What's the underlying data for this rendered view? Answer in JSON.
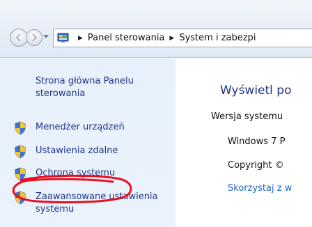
{
  "address_bar": {
    "breadcrumb": [
      "Panel sterowania",
      "System i zabezpi"
    ]
  },
  "left_pane": {
    "home_link": "Strona główna Panelu sterowania",
    "tasks": [
      {
        "label": "Menedżer urządzeń",
        "icon": "shield-icon",
        "highlighted": true
      },
      {
        "label": "Ustawienia zdalne",
        "icon": "shield-icon"
      },
      {
        "label": "Ochrona systemu",
        "icon": "shield-icon"
      },
      {
        "label": "Zaawansowane ustawienia systemu",
        "icon": "shield-icon"
      }
    ],
    "annotation_color": "#e8101e"
  },
  "content": {
    "title": "Wyświetl po",
    "section_label": "Wersja systemu",
    "edition": "Windows 7 P",
    "copyright": "Copyright ©",
    "more_link": "Skorzystaj z w"
  },
  "colors": {
    "link": "#1e3287",
    "pane_bg": "#e8f1fb",
    "accent_link": "#1b66c9"
  }
}
